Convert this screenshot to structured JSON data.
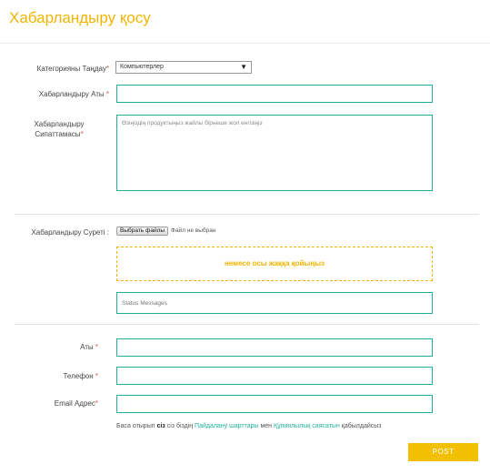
{
  "page": {
    "title": "Хабарландыру қосу"
  },
  "form": {
    "category": {
      "label": "Категорияны Таңдау",
      "required_mark": "*",
      "selected": "Компьютерлер",
      "arrow": "▼"
    },
    "ad_name": {
      "label": "Хабарландыру Аты",
      "required_mark": " *",
      "value": ""
    },
    "description": {
      "label_line1": "Хабарландыру",
      "label_line2": "Сипаттамасы",
      "required_mark": "*",
      "placeholder": "Өзіңіздің продуктыңыз жайлы бірнеше жол енгізіңіз"
    },
    "image": {
      "label": "Хабарландыру Суреті :",
      "choose_button": "Выбрать файлы",
      "file_status": "Файл не выбран",
      "dropzone_text": "немесе осы жаққа қойыңыз",
      "status_messages": "Status Messages"
    },
    "name": {
      "label": "Аты",
      "required_mark": " *",
      "value": ""
    },
    "phone": {
      "label": "Телефон",
      "required_mark": " *",
      "value": ""
    },
    "email": {
      "label": "Email Адрес",
      "required_mark": "*",
      "value": ""
    },
    "terms": {
      "prefix": "Баса отырып ",
      "bold": "сіз",
      "middle": " сіз біздің ",
      "link1": "Пайдалану шарттары",
      "conj": " мен ",
      "link2": "Құпиялылық саясатын",
      "suffix": " қабылдайсыз"
    },
    "submit_label": "POST"
  },
  "colors": {
    "accent": "#f0b500",
    "field_border": "#22b09a",
    "button": "#f2c000"
  }
}
